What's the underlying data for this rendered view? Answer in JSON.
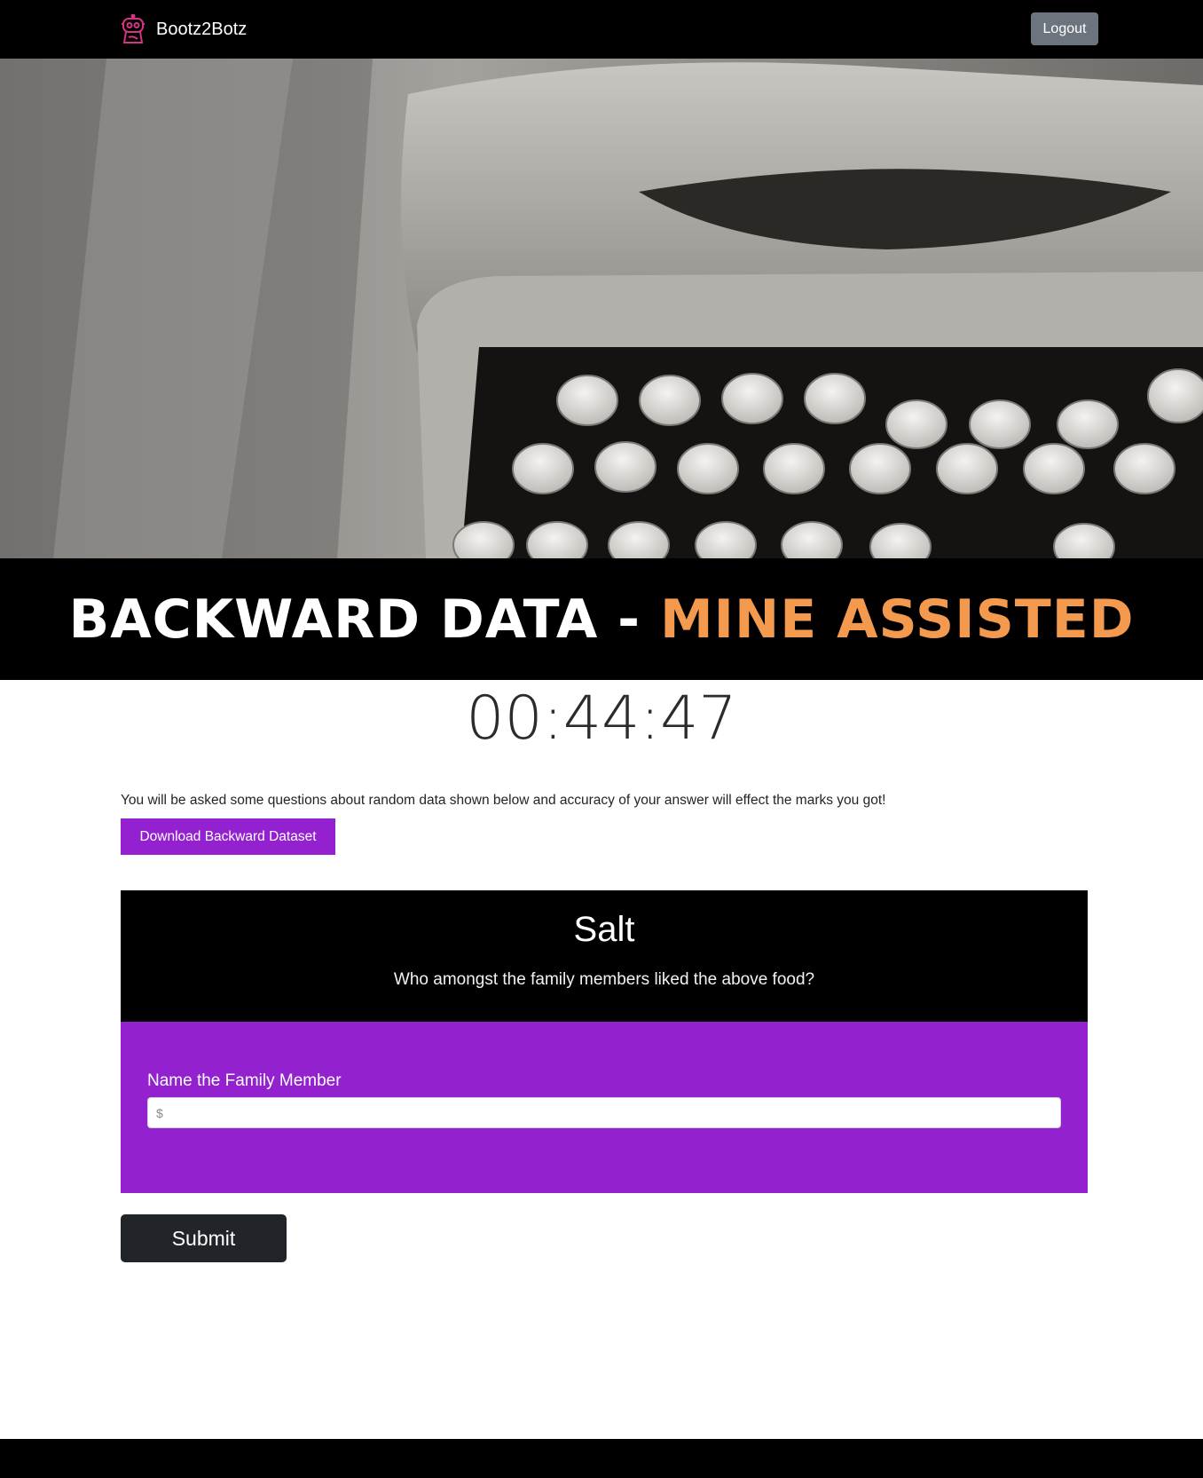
{
  "navbar": {
    "brand": "Bootz2Botz",
    "logout_label": "Logout",
    "logo_icon": "robot-icon",
    "logo_color": "#d63384"
  },
  "hero": {
    "image": "typewriter-photo"
  },
  "banner": {
    "title_main": "BACKWARD DATA - ",
    "title_accent": "MINE ASSISTED",
    "accent_color": "#f49a4f"
  },
  "timer": {
    "value": "00:44:47"
  },
  "intro": {
    "text": "You will be asked some questions about random data shown below and accuracy of your answer will effect the marks you got!",
    "download_label": "Download Backward Dataset"
  },
  "question": {
    "title": "Salt",
    "text": "Who amongst the family members liked the above food?",
    "field_label": "Name the Family Member",
    "input_placeholder": "$",
    "input_value": ""
  },
  "actions": {
    "submit_label": "Submit"
  },
  "colors": {
    "primary_purple": "#9321d0",
    "dark": "#000000",
    "secondary_button": "#6c757d",
    "submit_button": "#212529"
  }
}
